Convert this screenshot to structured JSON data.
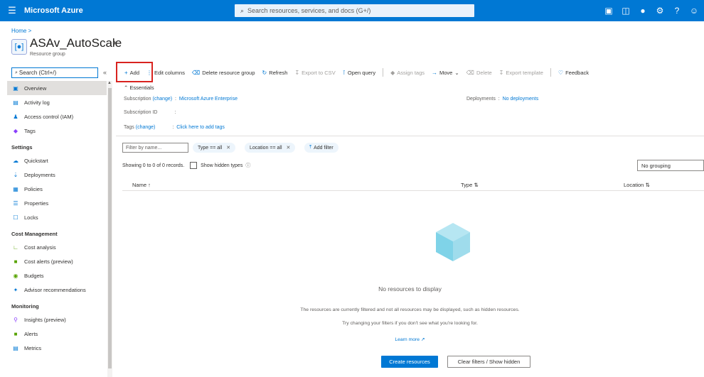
{
  "topbar": {
    "menu_icon": "hamburger-icon",
    "brand": "Microsoft Azure",
    "search_placeholder": "Search resources, services, and docs (G+/)",
    "icons": [
      "cloud-shell-icon",
      "directory-filter-icon",
      "notifications-icon",
      "settings-icon",
      "help-icon",
      "feedback-icon"
    ]
  },
  "breadcrumb": {
    "home": "Home"
  },
  "resource": {
    "title": "ASAv_AutoScale",
    "subtitle": "Resource group"
  },
  "sidebar": {
    "search_placeholder": "Search (Ctrl+/)",
    "collapse_glyph": "«",
    "items_top": [
      {
        "label": "Overview",
        "icon": "overview-icon",
        "active": true
      },
      {
        "label": "Activity log",
        "icon": "activity-log-icon"
      },
      {
        "label": "Access control (IAM)",
        "icon": "iam-icon"
      },
      {
        "label": "Tags",
        "icon": "tag-icon"
      }
    ],
    "settings_header": "Settings",
    "settings_items": [
      {
        "label": "Quickstart",
        "icon": "quickstart-icon"
      },
      {
        "label": "Deployments",
        "icon": "deployments-icon"
      },
      {
        "label": "Policies",
        "icon": "policies-icon"
      },
      {
        "label": "Properties",
        "icon": "properties-icon"
      },
      {
        "label": "Locks",
        "icon": "lock-icon"
      }
    ],
    "cost_header": "Cost Management",
    "cost_items": [
      {
        "label": "Cost analysis",
        "icon": "cost-analysis-icon"
      },
      {
        "label": "Cost alerts (preview)",
        "icon": "cost-alerts-icon"
      },
      {
        "label": "Budgets",
        "icon": "budgets-icon"
      },
      {
        "label": "Advisor recommendations",
        "icon": "advisor-icon"
      }
    ],
    "monitoring_header": "Monitoring",
    "monitoring_items": [
      {
        "label": "Insights (preview)",
        "icon": "insights-icon"
      },
      {
        "label": "Alerts",
        "icon": "alerts-icon"
      },
      {
        "label": "Metrics",
        "icon": "metrics-icon"
      }
    ]
  },
  "toolbar": {
    "add": "Add",
    "edit_columns": "Edit columns",
    "delete_group": "Delete resource group",
    "refresh": "Refresh",
    "export_csv": "Export to CSV",
    "open_query": "Open query",
    "assign_tags": "Assign tags",
    "move": "Move",
    "delete": "Delete",
    "export_template": "Export template",
    "feedback": "Feedback"
  },
  "essentials": {
    "header": "Essentials",
    "subscription_label": "Subscription",
    "change": "(change)",
    "subscription_value": "Microsoft Azure Enterprise",
    "subscription_id_label": "Subscription ID",
    "tags_label": "Tags",
    "tags_value": "Click here to add tags",
    "deployments_label": "Deployments",
    "deployments_value": "No deployments"
  },
  "filters": {
    "name_placeholder": "Filter by name...",
    "type_pill": "Type == all",
    "location_pill": "Location == all",
    "add_filter": "Add filter"
  },
  "list": {
    "showing": "Showing 0 to 0 of 0 records.",
    "show_hidden": "Show hidden types",
    "grouping": "No grouping",
    "col_name": "Name",
    "col_type": "Type",
    "col_location": "Location"
  },
  "empty": {
    "title": "No resources to display",
    "line1": "The resources are currently filtered and not all resources may be displayed, such as hidden resources.",
    "line2": "Try changing your filters if you don't see what you're looking for.",
    "learn_more": "Learn more",
    "create_button": "Create resources",
    "clear_button": "Clear filters / Show hidden"
  },
  "colors": {
    "azure_blue": "#0078d4",
    "highlight_red": "#d9231f",
    "cube": "#7fd3e8"
  }
}
